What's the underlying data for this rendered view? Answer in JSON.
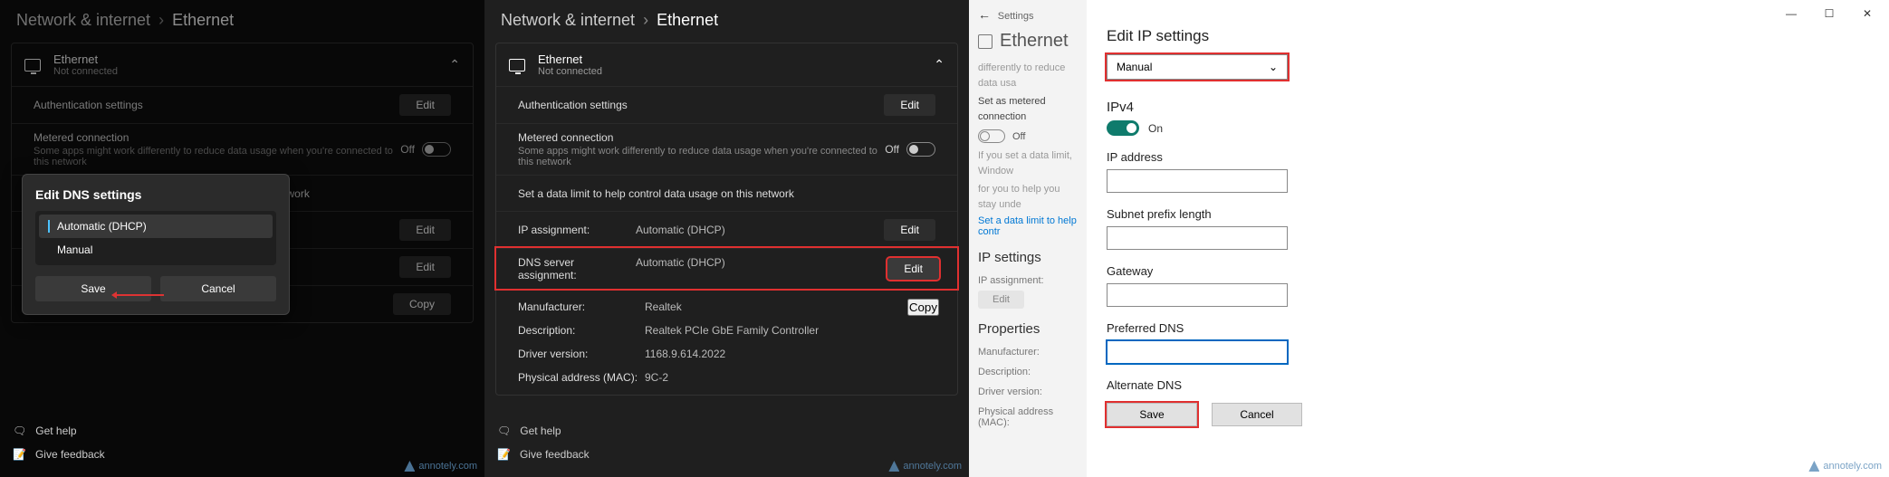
{
  "panel1": {
    "breadcrumb_parent": "Network & internet",
    "breadcrumb_current": "Ethernet",
    "ethernet": {
      "title": "Ethernet",
      "status": "Not connected"
    },
    "rows": {
      "auth": "Authentication settings",
      "metered": "Metered connection",
      "metered_sub": "Some apps might work differently to reduce data usage when you're connected to this network",
      "off": "Off",
      "datalimit": "Set a data limit to help control data usage on this network"
    },
    "btn_edit": "Edit",
    "btn_copy": "Copy",
    "popup": {
      "title": "Edit DNS settings",
      "opt_auto": "Automatic (DHCP)",
      "opt_manual": "Manual",
      "save": "Save",
      "cancel": "Cancel"
    },
    "help": "Get help",
    "feedback": "Give feedback",
    "watermark": "annotely.com"
  },
  "panel2": {
    "breadcrumb_parent": "Network & internet",
    "breadcrumb_current": "Ethernet",
    "ethernet": {
      "title": "Ethernet",
      "status": "Not connected"
    },
    "rows": {
      "auth": "Authentication settings",
      "metered": "Metered connection",
      "metered_sub": "Some apps might work differently to reduce data usage when you're connected to this network",
      "off": "Off",
      "datalimit": "Set a data limit to help control data usage on this network"
    },
    "kv": {
      "ip_k": "IP assignment:",
      "ip_v": "Automatic (DHCP)",
      "dns_k": "DNS server assignment:",
      "dns_v": "Automatic (DHCP)",
      "man_k": "Manufacturer:",
      "man_v": "Realtek",
      "desc_k": "Description:",
      "desc_v": "Realtek PCIe GbE Family Controller",
      "drv_k": "Driver version:",
      "drv_v": "1168.9.614.2022",
      "mac_k": "Physical address (MAC):",
      "mac_v": "9C-2"
    },
    "btn_edit": "Edit",
    "btn_copy": "Copy",
    "help": "Get help",
    "feedback": "Give feedback",
    "watermark": "annotely.com"
  },
  "panel3": {
    "side": {
      "settings": "Settings",
      "heading": "Ethernet",
      "faded1": "differently to reduce data usa",
      "metered": "Set as metered connection",
      "off": "Off",
      "faded2a": "If you set a data limit, Window",
      "faded2b": "for you to help you stay unde",
      "link": "Set a data limit to help contr",
      "ip_section": "IP settings",
      "ip_k": "IP assignment:",
      "edit": "Edit",
      "props": "Properties",
      "man_k": "Manufacturer:",
      "desc_k": "Description:",
      "drv_k": "Driver version:",
      "mac_k": "Physical address (MAC):"
    },
    "dlg": {
      "title": "Edit IP settings",
      "dd_value": "Manual",
      "ipv4": "IPv4",
      "on": "On",
      "ip_addr": "IP address",
      "subnet": "Subnet prefix length",
      "gateway": "Gateway",
      "prefdns": "Preferred DNS",
      "altdns": "Alternate DNS",
      "save": "Save",
      "cancel": "Cancel"
    },
    "watermark": "annotely.com"
  }
}
